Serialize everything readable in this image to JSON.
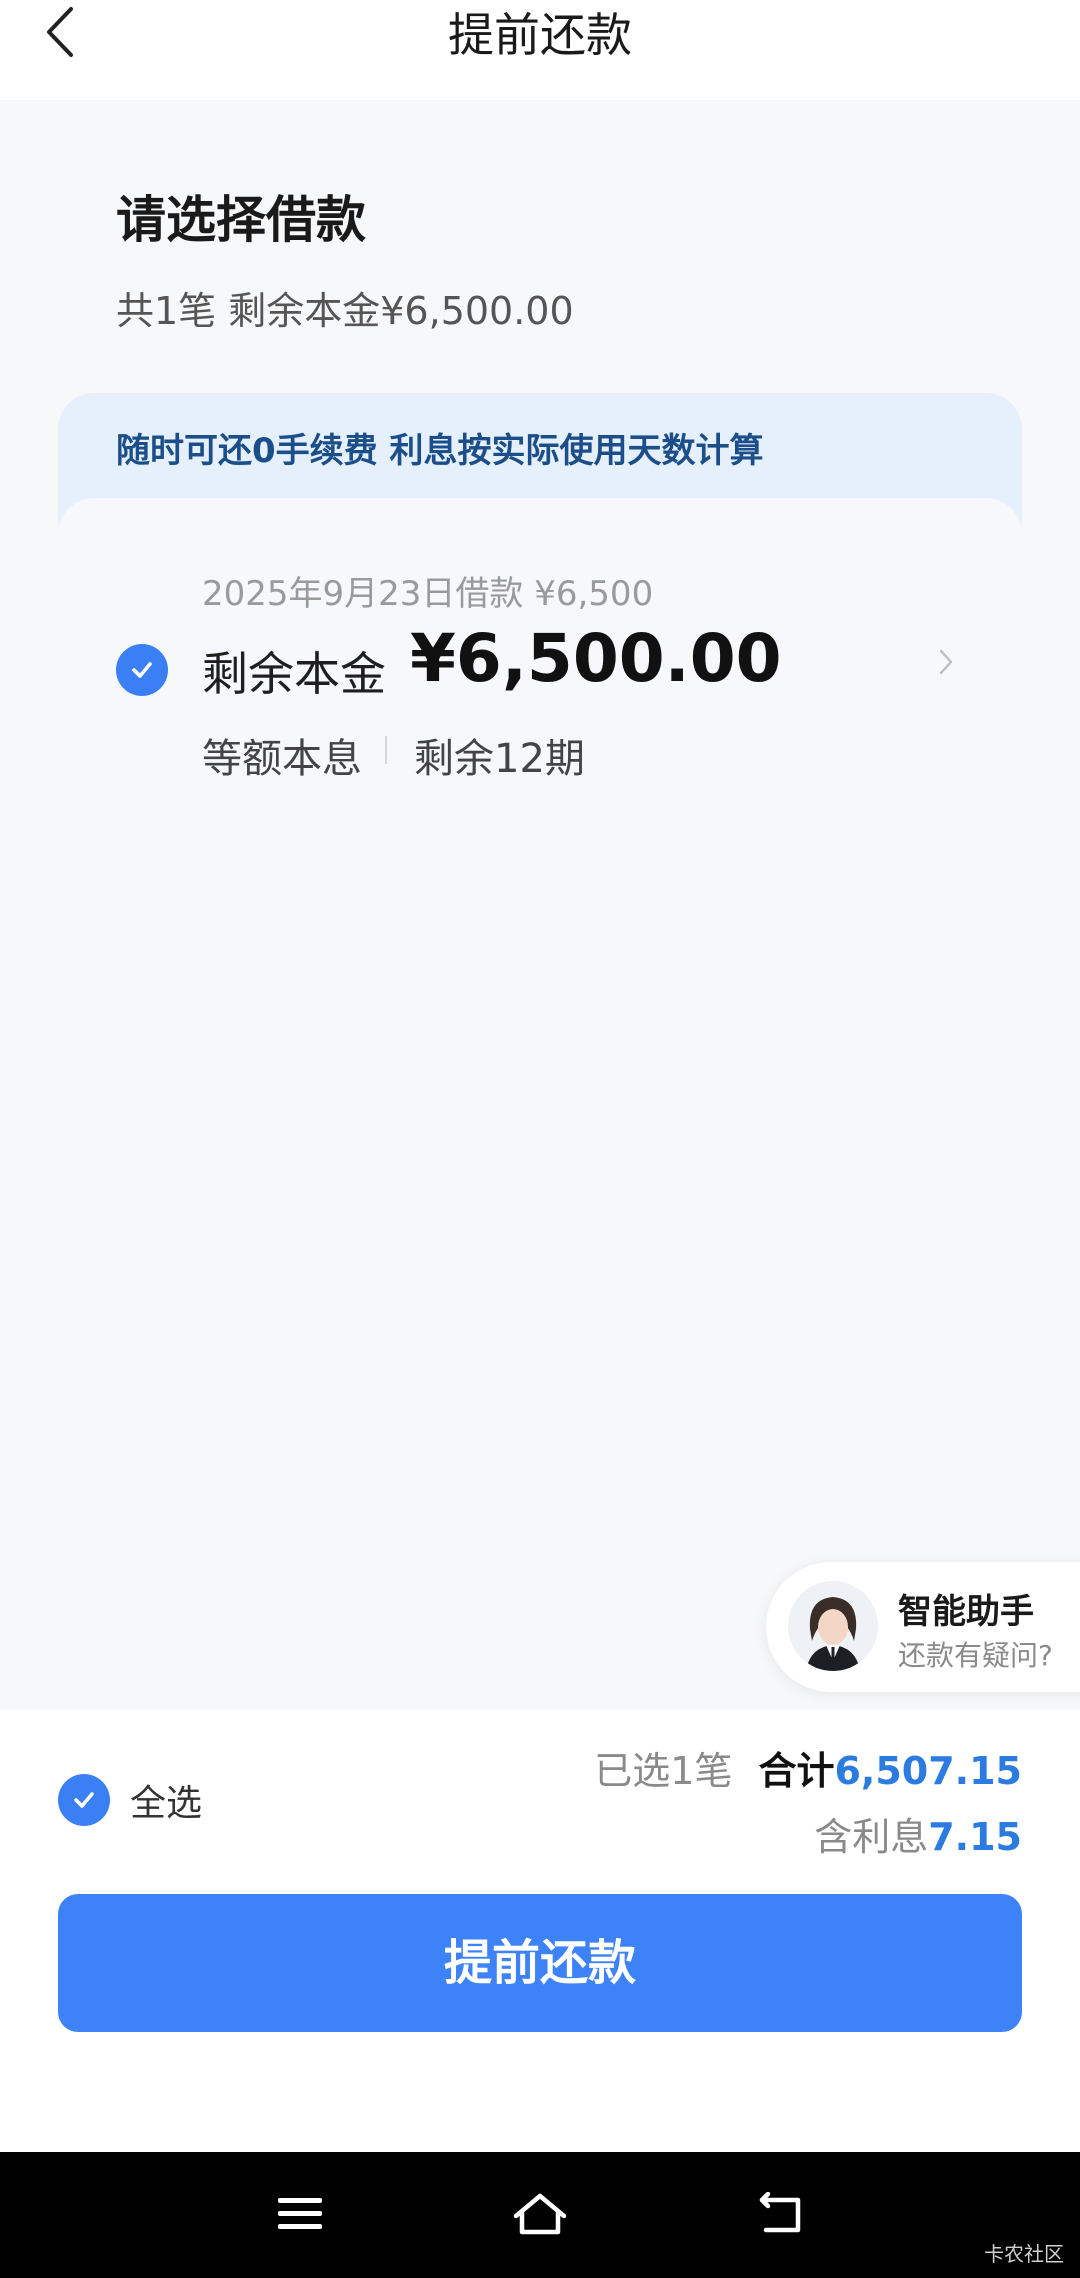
{
  "header": {
    "title": "提前还款"
  },
  "selection": {
    "title": "请选择借款",
    "summary": "共1笔 剩余本金¥6,500.00"
  },
  "notice": {
    "text": "随时可还0手续费 利息按实际使用天数计算"
  },
  "loan": {
    "date_line": "2025年9月23日借款 ¥6,500",
    "remaining_label": "剩余本金",
    "remaining_amount": "¥6,500.00",
    "repay_type": "等额本息",
    "remaining_periods": "剩余12期",
    "checked": true
  },
  "assistant": {
    "title": "智能助手",
    "subtitle": "还款有疑问?"
  },
  "footer": {
    "select_all_label": "全选",
    "selected_count": "已选1笔",
    "total_label": "合计",
    "total_value": "6,507.15",
    "interest_label": "含利息",
    "interest_value": "7.15",
    "submit_label": "提前还款"
  },
  "watermark": "卡农社区",
  "colors": {
    "accent": "#3d82f7",
    "amount_blue": "#2c7be0",
    "notice_bg": "#e6f0fd"
  }
}
